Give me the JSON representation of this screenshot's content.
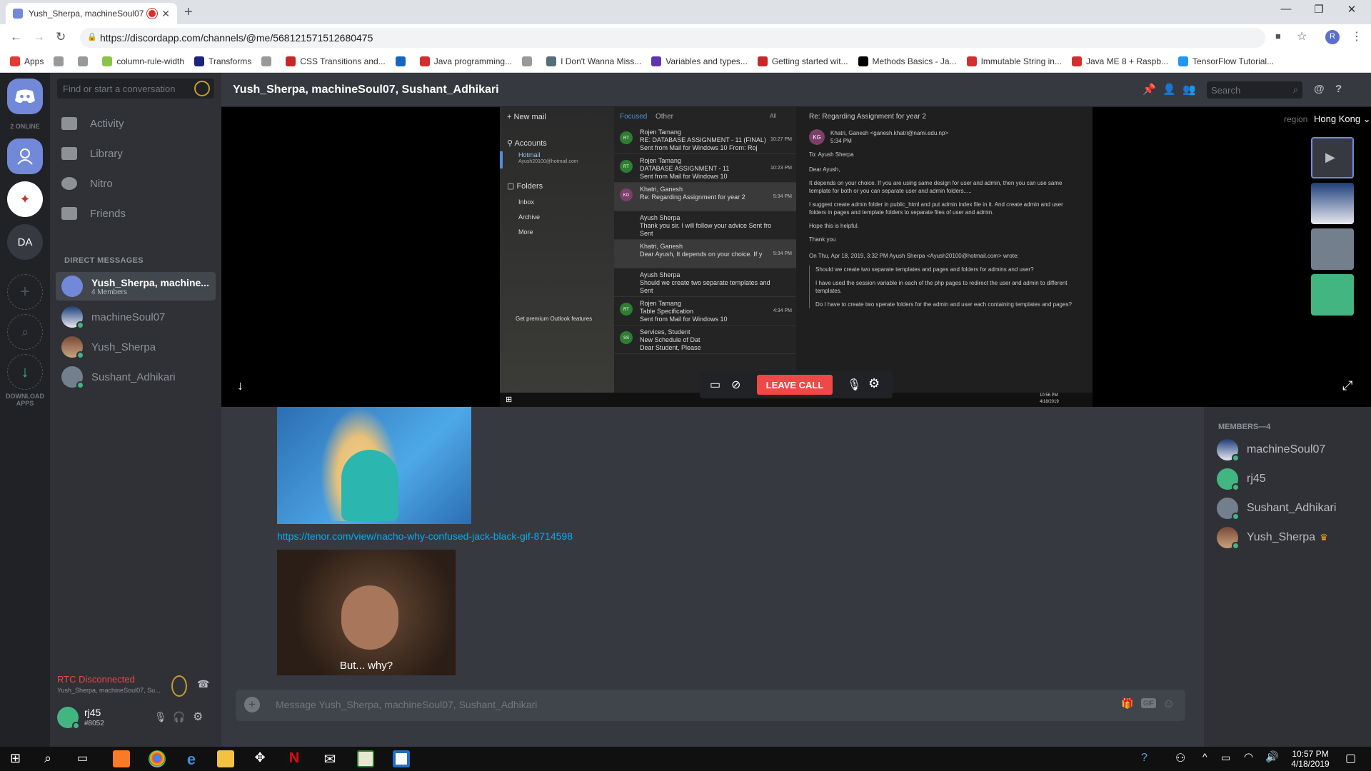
{
  "browser": {
    "tab_title": "Yush_Sherpa, machineSoul07",
    "url": "https://discordapp.com/channels/@me/568121571512680475",
    "profile_initial": "R",
    "bookmarks": [
      "Apps",
      "",
      "",
      "column-rule-width",
      "Transforms",
      "",
      "CSS Transitions and...",
      "",
      "Java programming...",
      "",
      "I Don't Wanna Miss...",
      "Variables and types...",
      "Getting started wit...",
      "Methods Basics - Ja...",
      "Immutable String in...",
      "Java ME 8 + Raspb...",
      "TensorFlow Tutorial..."
    ]
  },
  "guilds": {
    "online": "2 ONLINE",
    "server_initials": "DA",
    "download_label": "DOWNLOAD APPS"
  },
  "sidebar": {
    "search_placeholder": "Find or start a conversation",
    "nav": [
      "Activity",
      "Library",
      "Nitro",
      "Friends"
    ],
    "dm_header": "DIRECT MESSAGES",
    "dms": [
      {
        "name": "Yush_Sherpa, machine...",
        "sub": "4 Members"
      },
      {
        "name": "machineSoul07"
      },
      {
        "name": "Yush_Sherpa"
      },
      {
        "name": "Sushant_Adhikari"
      }
    ],
    "rtc_status": "RTC Disconnected",
    "rtc_sub": "Yush_Sherpa, machineSoul07, Su...",
    "user": {
      "name": "rj45",
      "tag": "#8052"
    }
  },
  "header": {
    "title": "Yush_Sherpa, machineSoul07, Sushant_Adhikari",
    "search_placeholder": "Search"
  },
  "call": {
    "region_label": "region",
    "region_value": "Hong Kong",
    "leave_label": "LEAVE CALL"
  },
  "shared_screen": {
    "new_mail": "New mail",
    "accounts": "Accounts",
    "account_name": "Hotmail",
    "account_email": "Ayush20100@hotmail.com",
    "folders": "Folders",
    "folder_items": [
      "Inbox",
      "Archive",
      "More"
    ],
    "premium": "Get premium Outlook features",
    "tabs": [
      "Focused",
      "Other",
      "All"
    ],
    "messages": [
      {
        "from": "Rojen Tamang",
        "subject": "RE: DATABASE ASSIGNMENT - 11 (FINAL)",
        "preview": "Sent from Mail for Windows 10 From: Roj",
        "time": "10:27 PM",
        "initials": "RT"
      },
      {
        "from": "Rojen Tamang",
        "subject": "DATABASE ASSIGNMENT - 11",
        "preview": "Sent from Mail for Windows 10",
        "time": "10:23 PM",
        "initials": "RT"
      },
      {
        "from": "Khatri, Ganesh",
        "subject": "Re: Regarding Assignment for year 2",
        "preview": "",
        "time": "5:34 PM",
        "initials": "KG"
      },
      {
        "from": "Ayush Sherpa",
        "subject": "Thank you sir. I will follow your advice Sent fro",
        "preview": "Sent",
        "time": "",
        "initials": ""
      },
      {
        "from": "Khatri, Ganesh",
        "subject": "Dear Ayush, It depends on your choice. If y",
        "preview": "",
        "time": "5:34 PM",
        "initials": ""
      },
      {
        "from": "Ayush Sherpa",
        "subject": "Should we create two separate templates and",
        "preview": "Sent",
        "time": "",
        "initials": ""
      },
      {
        "from": "Rojen Tamang",
        "subject": "Table Specification",
        "preview": "Sent from Mail for Windows 10",
        "time": "4:34 PM",
        "initials": "RT"
      },
      {
        "from": "Services, Student",
        "subject": "New Schedule of Dat",
        "preview": "Dear Student, Please",
        "time": "",
        "initials": "SS"
      }
    ],
    "reading": {
      "subject": "Re: Regarding Assignment for year 2",
      "sender": "Khatri, Ganesh <ganesh.khatri@nami.edu.np>",
      "time": "5:34 PM",
      "to": "To: Ayush Sherpa",
      "body": [
        "Dear Ayush,",
        "It depends on your choice. If you are using same design for user and admin, then you can use same template for both or you can separate user and admin folders.....",
        "I suggest create admin folder in public_html and put admin index file in it. And create admin and user folders in pages and template folders to separate files of user and admin.",
        "Hope this is helpful.",
        "Thank you"
      ],
      "quote_header": "On Thu, Apr 18, 2019, 3:32 PM Ayush Sherpa <Ayush20100@hotmail.com> wrote:",
      "quote": [
        "Should we create two separate templates and pages and folders for admins and user?",
        "I have used the session variable in each of the php pages to redirect the user and admin to different templates.",
        "Do I have to create two sperate folders for the admin and user each containing templates and pages?"
      ]
    },
    "task_time": "10:56 PM",
    "task_date": "4/18/2019"
  },
  "chat": {
    "link": "https://tenor.com/view/nacho-why-confused-jack-black-gif-8714598",
    "gif_caption": "But... why?",
    "composer_placeholder": "Message Yush_Sherpa, machineSoul07, Sushant_Adhikari"
  },
  "members": {
    "header": "MEMBERS—4",
    "list": [
      "machineSoul07",
      "rj45",
      "Sushant_Adhikari",
      "Yush_Sherpa"
    ]
  },
  "taskbar": {
    "time": "10:57 PM",
    "date": "4/18/2019"
  },
  "colors": {
    "blurple": "#7289da",
    "online": "#43b581",
    "danger": "#f04747",
    "link": "#00b0f4"
  }
}
